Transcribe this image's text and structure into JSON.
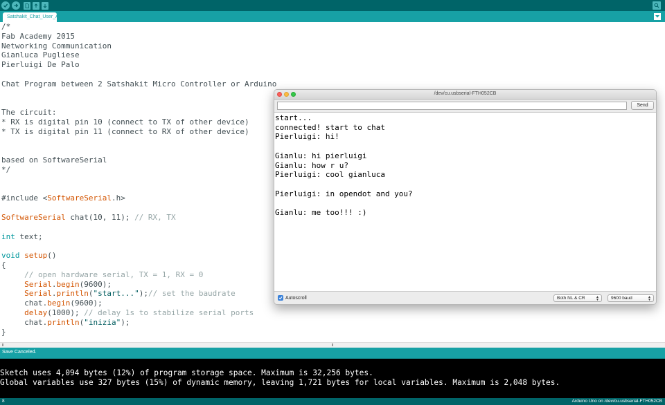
{
  "toolbar": {
    "buttons": [
      "verify-icon",
      "upload-icon",
      "new-icon",
      "open-icon",
      "save-icon"
    ],
    "search_icon": "serial-monitor-icon"
  },
  "tabs": [
    {
      "label": "Satshakit_Chat_User_A"
    }
  ],
  "editor": {
    "lines": [
      "/*",
      "Fab Academy 2015",
      "Networking Communication",
      "Gianluca Pugliese",
      "Pierluigi De Palo",
      "",
      "Chat Program between 2 Satshakit Micro Controller or Arduino",
      "",
      "",
      "The circuit:",
      "* RX is digital pin 10 (connect to TX of other device)",
      "* TX is digital pin 11 (connect to RX of other device)",
      "",
      "",
      "based on SoftwareSerial",
      "*/",
      "",
      "",
      "#include <SoftwareSerial.h>",
      "",
      "SoftwareSerial chat(10, 11); // RX, TX",
      "",
      "int text;",
      "",
      "void setup()",
      "{",
      "     // open hardware serial, TX = 1, RX = 0",
      "     Serial.begin(9600);",
      "     Serial.println(\"start...\");// set the baudrate",
      "     chat.begin(9600);",
      "     delay(1000); // delay 1s to stabilize serial ports",
      "     chat.println(\"inizia\");",
      "}"
    ]
  },
  "status": {
    "text": "Save Canceled."
  },
  "console": {
    "lines": [
      "Sketch uses 4,094 bytes (12%) of program storage space. Maximum is 32,256 bytes.",
      "Global variables use 327 bytes (15%) of dynamic memory, leaving 1,721 bytes for local variables. Maximum is 2,048 bytes."
    ]
  },
  "footer": {
    "line_number": "8",
    "board": "Arduino Uno on /dev/cu.usbserial-FTH052CB"
  },
  "serial_monitor": {
    "title": "/dev/cu.usbserial-FTH052CB",
    "input_value": "",
    "send_label": "Send",
    "output_lines": [
      "start...",
      "connected! start to chat",
      "Pierluigi: hi!",
      "",
      "Gianlu: hi pierluigi",
      "Gianlu: how r u?",
      "Pierluigi: cool gianluca",
      "",
      "Pierluigi: in opendot and you?",
      "",
      "Gianlu: me too!!! :)"
    ],
    "autoscroll_label": "Autoscroll",
    "autoscroll_checked": true,
    "line_ending": "Both NL & CR",
    "baud": "9600 baud"
  },
  "colors": {
    "toolbar_bg": "#006468",
    "tab_bar_bg": "#17a1a5",
    "keyword_orange": "#d35400",
    "keyword_teal": "#00979c",
    "comment_gray": "#95a5a6"
  }
}
